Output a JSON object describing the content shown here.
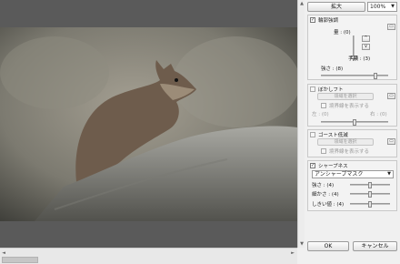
{
  "toolbar": {
    "zoom_button": "拡大",
    "zoom_value": "100%"
  },
  "hscroll": {
    "left_arrow": "◄",
    "right_arrow": "►"
  },
  "vscroll": {
    "up_arrow": "▲",
    "down_arrow": "▼"
  },
  "contour": {
    "title": "輪郭強調",
    "checked": true,
    "strength_label": "量 : (0)",
    "step_label": "手順 : (3)",
    "thickness_label": "強さ : (8)"
  },
  "soften": {
    "title": "ぼかしフト",
    "checked": false,
    "select_button": "領域を選択",
    "show_border": "境界線を表示する",
    "left_label": "左 : (0)",
    "right_label": "右 : (0)"
  },
  "ghost": {
    "title": "ゴースト低減",
    "checked": false,
    "select_button": "領域を選択",
    "show_border": "境界線を表示する"
  },
  "sharpness": {
    "title": "シャープネス",
    "checked": true,
    "method": "アンシャープマスク",
    "strength_label": "強さ : (4)",
    "fineness_label": "細かさ : (4)",
    "threshold_label": "しきい値 : (4)"
  },
  "footer": {
    "ok": "OK",
    "cancel": "キャンセル"
  }
}
